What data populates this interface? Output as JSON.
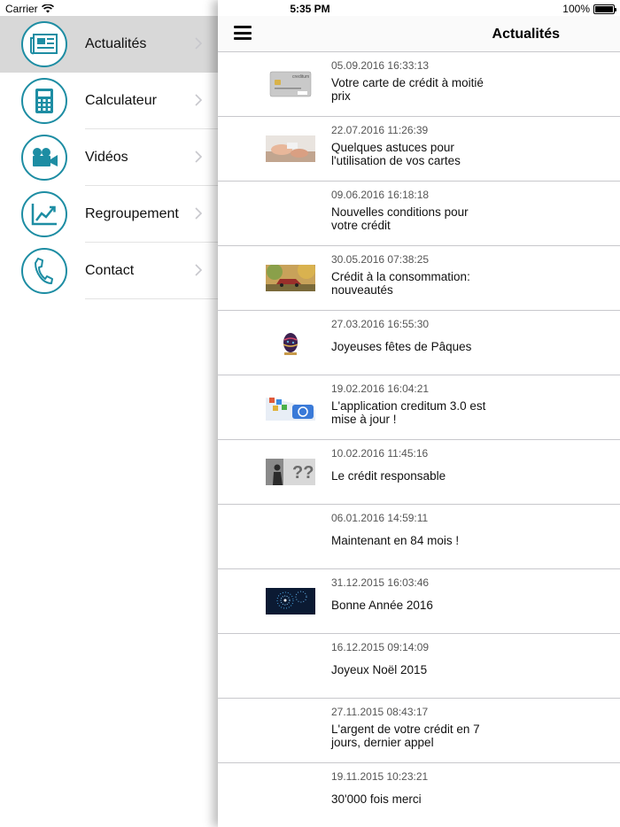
{
  "status_bar": {
    "carrier": "Carrier",
    "time": "5:35 PM",
    "battery": "100%"
  },
  "menu": {
    "items": [
      {
        "label": "Actualités",
        "icon": "newspaper-icon",
        "active": true
      },
      {
        "label": "Calculateur",
        "icon": "calculator-icon",
        "active": false
      },
      {
        "label": "Vidéos",
        "icon": "video-camera-icon",
        "active": false
      },
      {
        "label": "Regroupement",
        "icon": "chart-line-icon",
        "active": false
      },
      {
        "label": "Contact",
        "icon": "phone-icon",
        "active": false
      }
    ]
  },
  "nav": {
    "title": "Actualités"
  },
  "news": [
    {
      "date": "05.09.2016 16:33:13",
      "title": "Votre carte de crédit à moitié prix",
      "thumb_text": "creditum"
    },
    {
      "date": "22.07.2016 11:26:39",
      "title": "Quelques astuces pour l'utilisation de vos cartes"
    },
    {
      "date": "09.06.2016 16:18:18",
      "title": "Nouvelles conditions pour votre crédit"
    },
    {
      "date": "30.05.2016 07:38:25",
      "title": "Crédit à la consommation: nouveautés"
    },
    {
      "date": "27.03.2016 16:55:30",
      "title": "Joyeuses fêtes de Pâques"
    },
    {
      "date": "19.02.2016 16:04:21",
      "title": "L'application creditum 3.0 est mise à jour !"
    },
    {
      "date": "10.02.2016 11:45:16",
      "title": "Le crédit responsable"
    },
    {
      "date": "06.01.2016 14:59:11",
      "title": "Maintenant en 84 mois !"
    },
    {
      "date": "31.12.2015 16:03:46",
      "title": "Bonne Année 2016"
    },
    {
      "date": "16.12.2015 09:14:09",
      "title": "Joyeux Noël 2015"
    },
    {
      "date": "27.11.2015 08:43:17",
      "title": "L'argent de votre crédit en 7 jours, dernier appel"
    },
    {
      "date": "19.11.2015 10:23:21",
      "title": "30'000 fois merci"
    }
  ],
  "colors": {
    "accent": "#1d8da3",
    "active_row": "#d8d8d8"
  }
}
